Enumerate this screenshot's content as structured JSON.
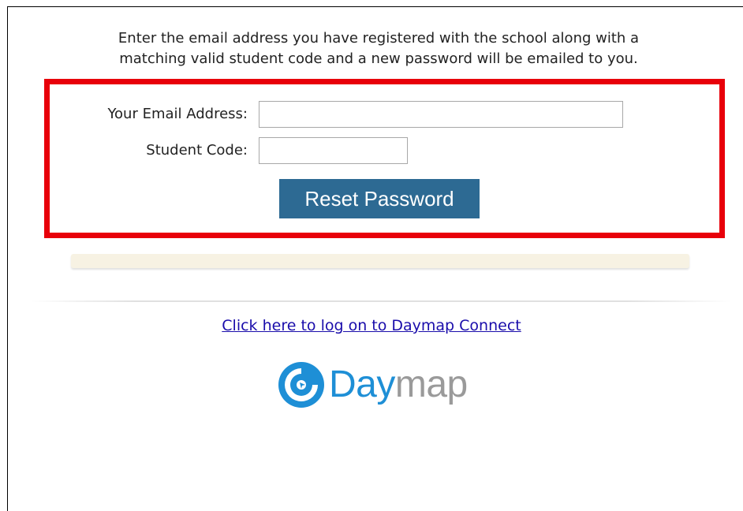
{
  "instructions": {
    "line1": "Enter the email address you have registered with the school along with a",
    "line2": "matching valid student code and a new password will be emailed to you."
  },
  "form": {
    "email_label": "Your Email Address:",
    "email_value": "",
    "code_label": "Student Code:",
    "code_value": "",
    "reset_button_label": "Reset Password"
  },
  "message_bar": {
    "text": ""
  },
  "links": {
    "logon_label": "Click here to log on to Daymap Connect"
  },
  "logo": {
    "icon": "daymap-swirl-icon",
    "word_part1": "Day",
    "word_part2": "map",
    "colors": {
      "primary": "#1e8fd6",
      "secondary": "#9a9a9a"
    }
  },
  "colors": {
    "highlight_border": "#e8000a",
    "button_bg": "#2d6a93",
    "link": "#1a0dab",
    "message_bar_bg": "#f7f2e3"
  }
}
